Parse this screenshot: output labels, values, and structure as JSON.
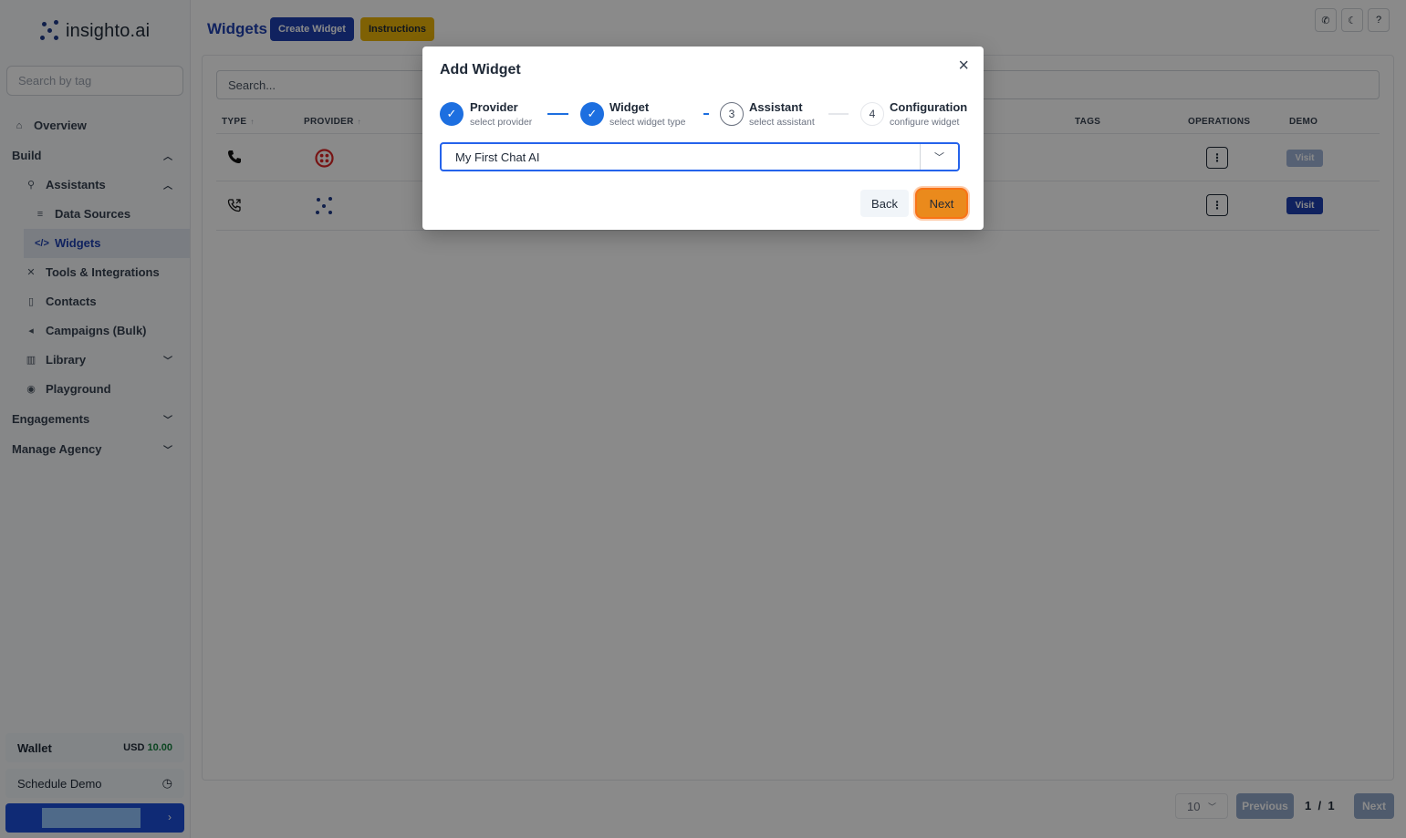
{
  "app": {
    "logo_text": "insighto.ai",
    "tag_search_placeholder": "Search by tag"
  },
  "sidebar": {
    "overview": "Overview",
    "build": "Build",
    "assistants": "Assistants",
    "data_sources": "Data Sources",
    "widgets": "Widgets",
    "tools": "Tools & Integrations",
    "contacts": "Contacts",
    "campaigns": "Campaigns (Bulk)",
    "library": "Library",
    "playground": "Playground",
    "engagements": "Engagements",
    "manage_agency": "Manage Agency",
    "wallet_label": "Wallet",
    "wallet_currency": "USD",
    "wallet_amount": "10.00",
    "schedule_demo": "Schedule Demo"
  },
  "header": {
    "title": "Widgets",
    "create_widget": "Create Widget",
    "instructions": "Instructions"
  },
  "table": {
    "search_placeholder": "Search...",
    "columns": [
      "TYPE",
      "PROVIDER",
      "TAGS",
      "OPERATIONS",
      "DEMO"
    ],
    "sort_indicator": "↑",
    "ops_label": "⋮",
    "visit_label": "Visit",
    "rows": [
      {
        "type_icon": "phone-icon",
        "provider_icon": "twilio-icon",
        "visit_enabled": false
      },
      {
        "type_icon": "phone-forward-icon",
        "provider_icon": "insighto-icon",
        "visit_enabled": true
      }
    ]
  },
  "pagination": {
    "page_size": "10",
    "previous": "Previous",
    "current": "1",
    "separator": "/",
    "total": "1",
    "next": "Next"
  },
  "modal": {
    "title": "Add Widget",
    "steps": [
      {
        "number": "✓",
        "title": "Provider",
        "subtitle": "select provider",
        "status": "done"
      },
      {
        "number": "✓",
        "title": "Widget",
        "subtitle": "select widget type",
        "status": "done"
      },
      {
        "number": "3",
        "title": "Assistant",
        "subtitle": "select assistant",
        "status": "current"
      },
      {
        "number": "4",
        "title": "Configuration",
        "subtitle": "configure widget",
        "status": "todo"
      }
    ],
    "selected_assistant": "My First Chat AI",
    "back": "Back",
    "next": "Next"
  },
  "colors": {
    "brand_blue": "#1e40af",
    "step_done": "#1d6fe0",
    "next_button": "#ea8a1c",
    "wallet_amount": "#15803d",
    "instructions_button": "#eab308"
  }
}
